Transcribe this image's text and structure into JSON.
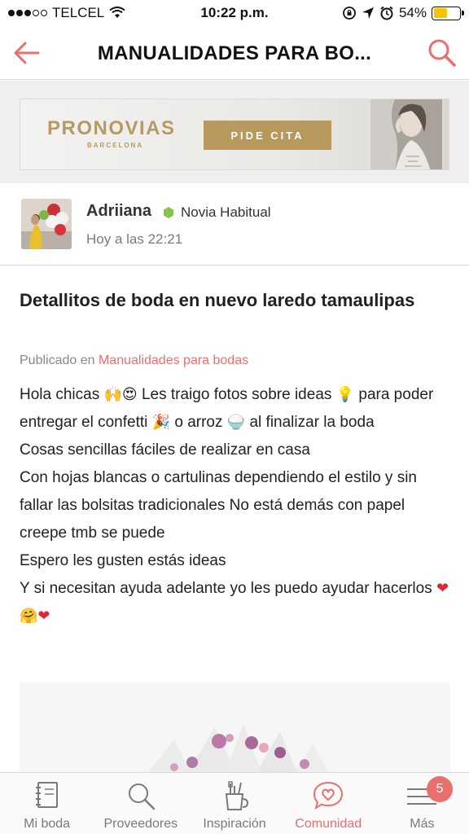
{
  "status_bar": {
    "carrier": "TELCEL",
    "time": "10:22 p.m.",
    "battery": "54%",
    "battery_level": 0.54
  },
  "header": {
    "title": "MANUALIDADES PARA BO..."
  },
  "banner": {
    "brand": "PRONOVIAS",
    "brand_sub": "BARCELONA",
    "cta": "PIDE CITA"
  },
  "author": {
    "name": "Adriiana",
    "level": "Novia Habitual",
    "time": "Hoy a las 22:21"
  },
  "post": {
    "title": "Detallitos de boda en nuevo laredo tamaulipas",
    "published_prefix": "Publicado en",
    "category": "Manualidades para bodas",
    "body": {
      "p1a": "Hola chicas",
      "p1b": "Les traigo fotos sobre ideas",
      "p1c": "para poder entregar el confetti",
      "p1d": "o arroz",
      "p1e": "al finalizar la boda",
      "p2": "Cosas sencillas fáciles de realizar en casa",
      "p3": "Con hojas blancas o cartulinas dependiendo el estilo y sin fallar las bolsitas tradicionales No está demás con papel creepe tmb se puede",
      "p4": "Espero les gusten estás ideas",
      "p5": "Y si necesitan ayuda adelante yo les puedo ayudar hacerlos"
    },
    "emojis": {
      "raised_hands": "🙌",
      "heart_eyes": "😍",
      "bulb": "💡",
      "confetti": "🎉",
      "rice": "🍚",
      "heart": "❤",
      "hug": "🤗"
    }
  },
  "tabbar": {
    "tabs": [
      {
        "label": "Mi boda",
        "icon": "notebook-icon"
      },
      {
        "label": "Proveedores",
        "icon": "search-icon"
      },
      {
        "label": "Inspiración",
        "icon": "paint-brushes-icon"
      },
      {
        "label": "Comunidad",
        "icon": "heart-chat-icon"
      },
      {
        "label": "Más",
        "icon": "menu-icon"
      }
    ],
    "active_tab": "Comunidad",
    "badge": "5"
  },
  "colors": {
    "accent": "#e96f6f",
    "brand_gold": "#b7995e",
    "level_green": "#8bc34a"
  }
}
